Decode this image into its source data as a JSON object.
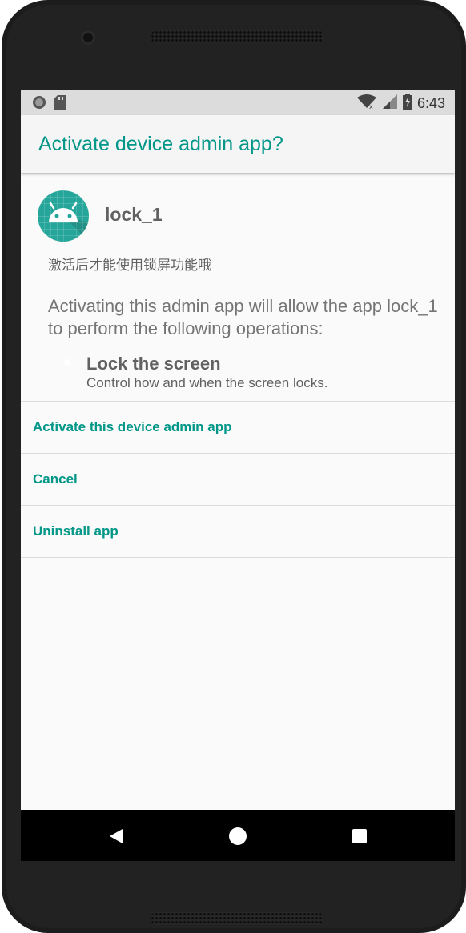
{
  "status_bar": {
    "time": "6:43",
    "icons": [
      "circle-notification-icon",
      "sd-card-icon",
      "wifi-icon",
      "cellular-signal-icon",
      "battery-charging-icon"
    ]
  },
  "dialog": {
    "title": "Activate device admin app?",
    "app_name": "lock_1",
    "app_description": "激活后才能使用锁屏功能哦",
    "explanation": "Activating this admin app will allow the app lock_1 to perform the following operations:",
    "permissions": [
      {
        "title": "Lock the screen",
        "description": "Control how and when the screen locks."
      }
    ],
    "actions": [
      {
        "label": "Activate this device admin app"
      },
      {
        "label": "Cancel"
      },
      {
        "label": "Uninstall app"
      }
    ]
  },
  "nav_bar": {
    "buttons": [
      "back-icon",
      "home-icon",
      "recents-icon"
    ]
  },
  "colors": {
    "accent": "#009688",
    "icon_bg": "#26a69a",
    "text_secondary": "#616161",
    "status_bar_bg": "#dcdcdc",
    "nav_bar_bg": "#000000"
  }
}
